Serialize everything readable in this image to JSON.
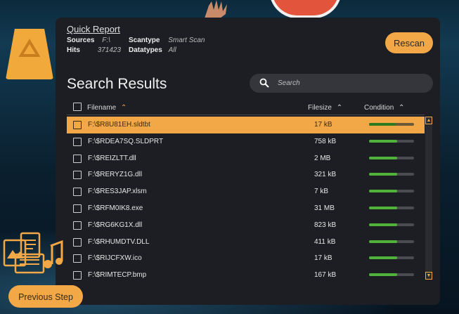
{
  "quick_report": {
    "title": "Quick Report",
    "sources_label": "Sources",
    "sources_value": "F:\\",
    "hits_label": "Hits",
    "hits_value": "371423",
    "scantype_label": "Scantype",
    "scantype_value": "Smart Scan",
    "datatypes_label": "Datatypes",
    "datatypes_value": "All"
  },
  "rescan_label": "Rescan",
  "results_title": "Search Results",
  "search": {
    "placeholder": "Search"
  },
  "columns": {
    "filename": "Filename",
    "filesize": "Filesize",
    "condition": "Condition"
  },
  "rows": [
    {
      "name": "F:\\$R8U81EH.sldtbt",
      "size": "17 kB",
      "condition": 0.6,
      "selected": true
    },
    {
      "name": "F:\\$RDEA7SQ.SLDPRT",
      "size": "758 kB",
      "condition": 0.62
    },
    {
      "name": "F:\\$REIZLTT.dll",
      "size": "2 MB",
      "condition": 0.62
    },
    {
      "name": "F:\\$RERYZ1G.dll",
      "size": "321 kB",
      "condition": 0.62
    },
    {
      "name": "F:\\$RES3JAP.xlsm",
      "size": "7 kB",
      "condition": 0.62
    },
    {
      "name": "F:\\$RFM0IK8.exe",
      "size": "31 MB",
      "condition": 0.62
    },
    {
      "name": "F:\\$RG6KG1X.dll",
      "size": "823 kB",
      "condition": 0.62
    },
    {
      "name": "F:\\$RHUMDTV.DLL",
      "size": "411 kB",
      "condition": 0.62
    },
    {
      "name": "F:\\$RIJCFXW.ico",
      "size": "17 kB",
      "condition": 0.62
    },
    {
      "name": "F:\\$RIMTECP.bmp",
      "size": "167 kB",
      "condition": 0.62
    }
  ],
  "previous_step_label": "Previous Step",
  "colors": {
    "accent": "#f3a847",
    "panel": "#1d1e23",
    "bar_fill": "#4fb33a"
  }
}
